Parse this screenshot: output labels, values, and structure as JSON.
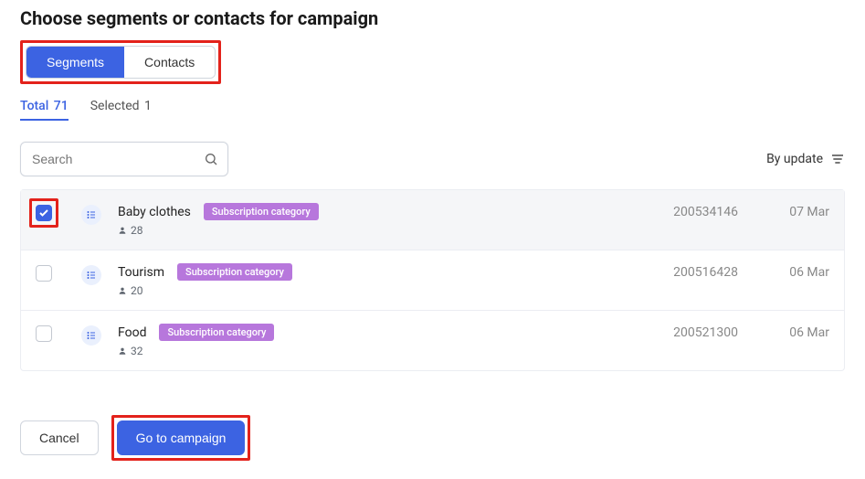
{
  "title": "Choose segments or contacts for campaign",
  "mode_tabs": {
    "segments": "Segments",
    "contacts": "Contacts"
  },
  "count_tabs": {
    "total_label": "Total",
    "total_value": "71",
    "selected_label": "Selected",
    "selected_value": "1"
  },
  "search": {
    "placeholder": "Search"
  },
  "sort": {
    "label": "By update"
  },
  "badge_text": "Subscription category",
  "rows": [
    {
      "checked": true,
      "name": "Baby clothes",
      "count": "28",
      "id": "200534146",
      "date": "07 Mar"
    },
    {
      "checked": false,
      "name": "Tourism",
      "count": "20",
      "id": "200516428",
      "date": "06 Mar"
    },
    {
      "checked": false,
      "name": "Food",
      "count": "32",
      "id": "200521300",
      "date": "06 Mar"
    }
  ],
  "footer": {
    "cancel": "Cancel",
    "go": "Go to campaign"
  }
}
